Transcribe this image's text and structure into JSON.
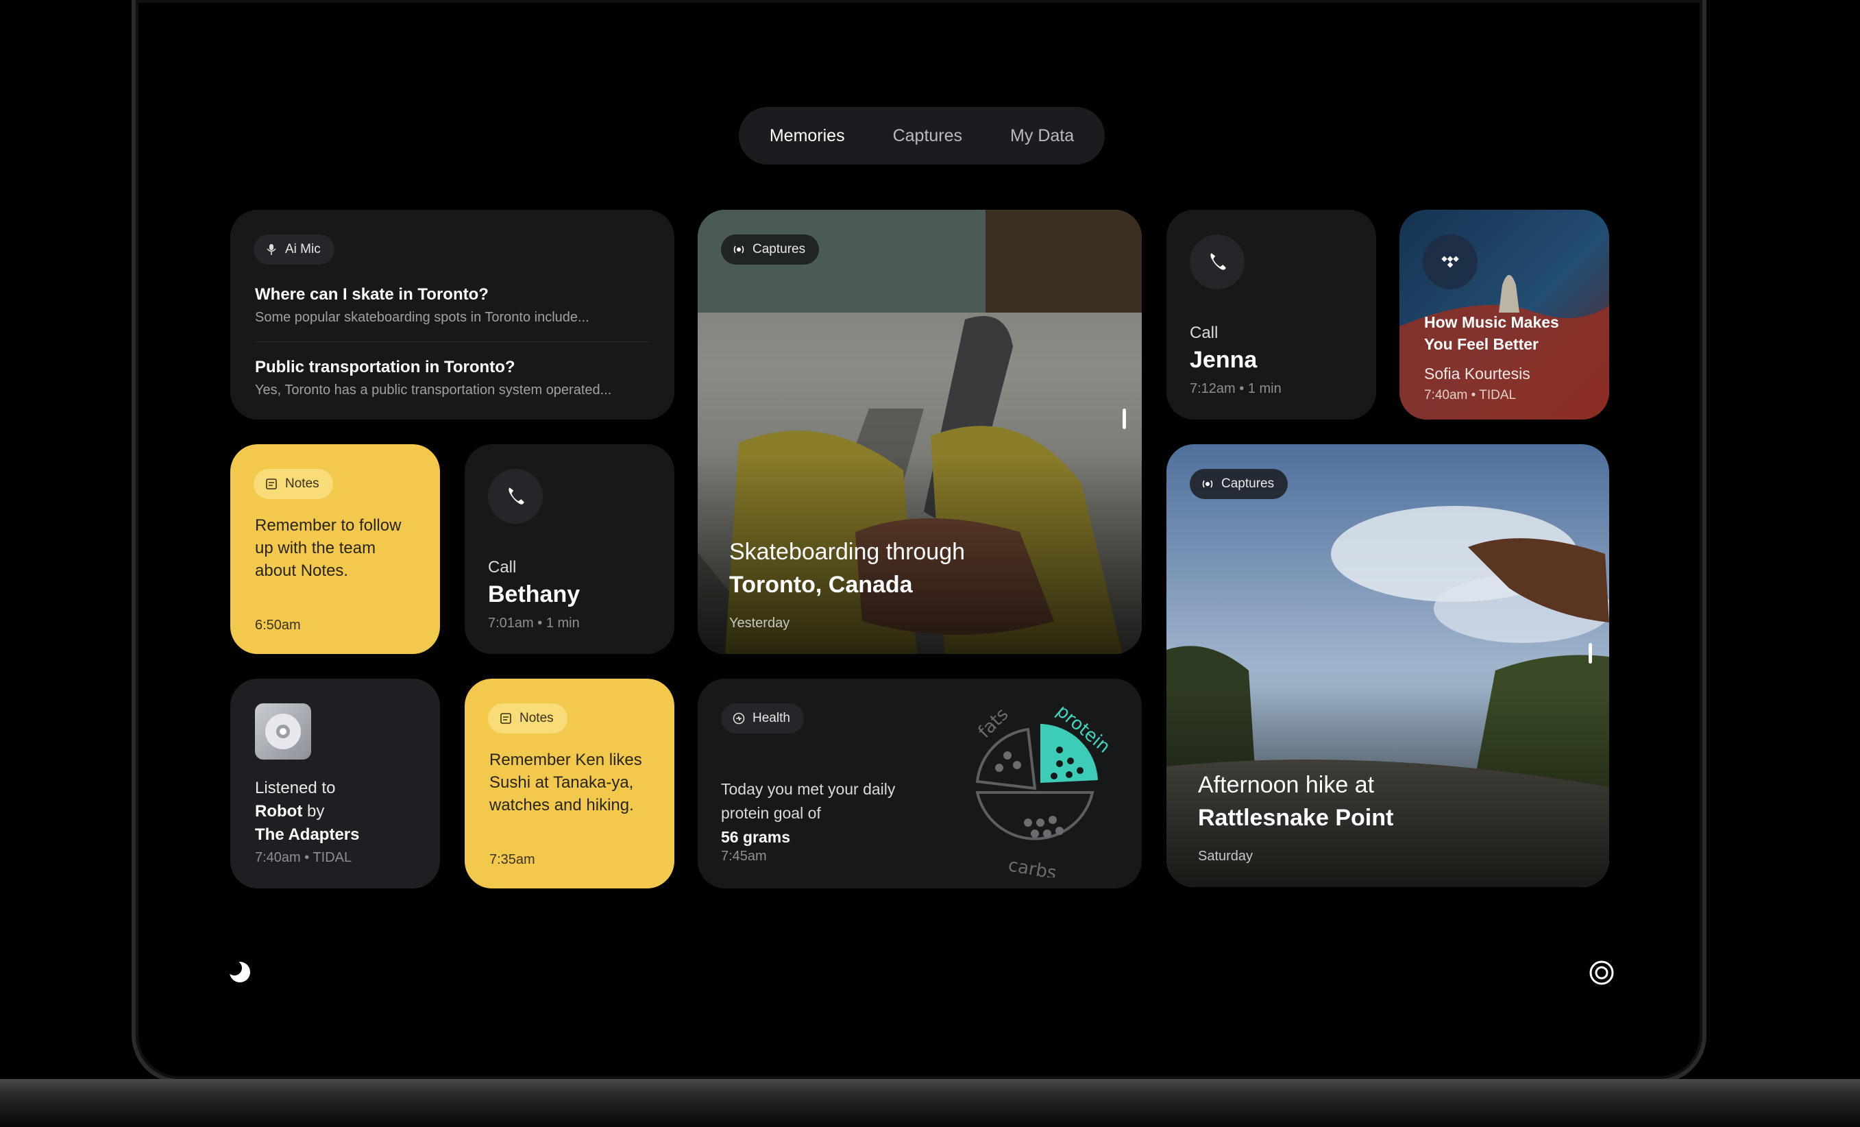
{
  "tabs": [
    {
      "label": "Memories",
      "active": true
    },
    {
      "label": "Captures",
      "active": false
    },
    {
      "label": "My Data",
      "active": false
    }
  ],
  "ai_card": {
    "chip": "Ai Mic",
    "chip_icon": "microphone-icon",
    "items": [
      {
        "title": "Where can I skate in Toronto?",
        "subtitle": "Some popular skateboarding spots in Toronto include..."
      },
      {
        "title": "Public transportation in Toronto?",
        "subtitle": "Yes, Toronto has a public transportation system operated..."
      }
    ]
  },
  "skate_card": {
    "chip": "Captures",
    "chip_icon": "capture-icon",
    "title_line1": "Skateboarding through",
    "title_line2": "Toronto, Canada",
    "meta": "Yesterday"
  },
  "call_jenna": {
    "icon": "phone-icon",
    "label": "Call",
    "name": "Jenna",
    "meta": "7:12am • 1 min"
  },
  "music_card": {
    "icon": "tidal-icon",
    "title": "How Music Makes You Feel Better",
    "artist": "Sofia Kourtesis",
    "meta": "7:40am • TIDAL"
  },
  "note1": {
    "chip": "Notes",
    "chip_icon": "notes-icon",
    "text": "Remember to follow up with the team about Notes.",
    "time": "6:50am",
    "color": "#f2c94c"
  },
  "call_bethany": {
    "icon": "phone-icon",
    "label": "Call",
    "name": "Bethany",
    "meta": "7:01am • 1 min"
  },
  "hike_card": {
    "chip": "Captures",
    "chip_icon": "capture-icon",
    "title_line1": "Afternoon hike at",
    "title_line2": "Rattlesnake Point",
    "meta": "Saturday"
  },
  "listen_card": {
    "icon": "cd-icon",
    "line1": "Listened to",
    "song": "Robot",
    "by": "by",
    "artist": "The Adapters",
    "meta": "7:40am • TIDAL"
  },
  "note2": {
    "chip": "Notes",
    "chip_icon": "notes-icon",
    "text": "Remember Ken likes Sushi at Tanaka-ya, watches and hiking.",
    "time": "7:35am"
  },
  "health_card": {
    "chip": "Health",
    "chip_icon": "health-icon",
    "text": "Today you met your daily protein goal of",
    "goal": "56 grams",
    "time": "7:45am",
    "chart_labels": {
      "fats": "fats",
      "protein": "protein",
      "carbs": "carbs"
    },
    "accent": "#3fd6c0"
  },
  "footer": {
    "left_icon": "moon-icon",
    "right_icon": "settings-ring-icon"
  }
}
